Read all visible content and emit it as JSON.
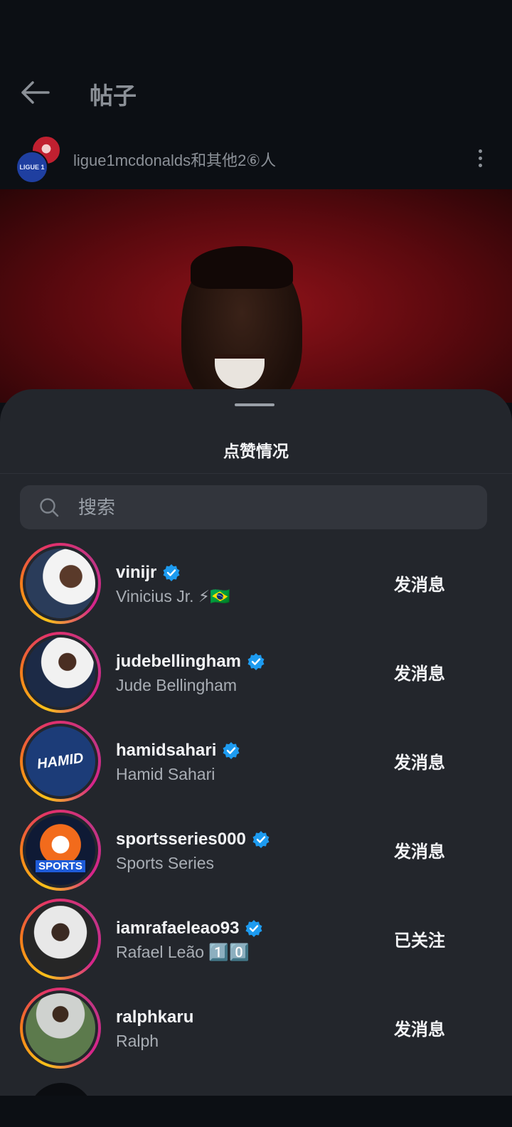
{
  "header": {
    "title": "帖子",
    "post_author": "ligue1mcdonalds和其他2⑥人",
    "avatar_badge": "LIGUE 1"
  },
  "sheet": {
    "title": "点赞情况",
    "search": {
      "placeholder": "搜索",
      "value": ""
    }
  },
  "likes": [
    {
      "username": "vinijr",
      "full_name": "Vinicius Jr. ⚡🇧🇷",
      "verified": true,
      "action": "发消息"
    },
    {
      "username": "judebellingham",
      "full_name": "Jude Bellingham",
      "verified": true,
      "action": "发消息"
    },
    {
      "username": "hamidsahari",
      "full_name": "Hamid Sahari",
      "verified": true,
      "action": "发消息",
      "avatar_text": "HAMID"
    },
    {
      "username": "sportsseries000",
      "full_name": "Sports Series",
      "verified": true,
      "action": "发消息",
      "avatar_text": "SPORTS"
    },
    {
      "username": "iamrafaeleao93",
      "full_name": "Rafael Leão 1️⃣0️⃣",
      "verified": true,
      "action": "已关注"
    },
    {
      "username": "ralphkaru",
      "full_name": "Ralph",
      "verified": false,
      "action": "发消息"
    }
  ],
  "colors": {
    "background": "#0c0f14",
    "sheet": "#23262c",
    "verified": "#1d9bf0",
    "story_ring": [
      "#f9c21a",
      "#e1306c",
      "#c13584"
    ]
  },
  "icons": {
    "back": "arrow-left-icon",
    "more": "more-vertical-icon",
    "search": "search-icon",
    "verified": "verified-badge-icon"
  }
}
